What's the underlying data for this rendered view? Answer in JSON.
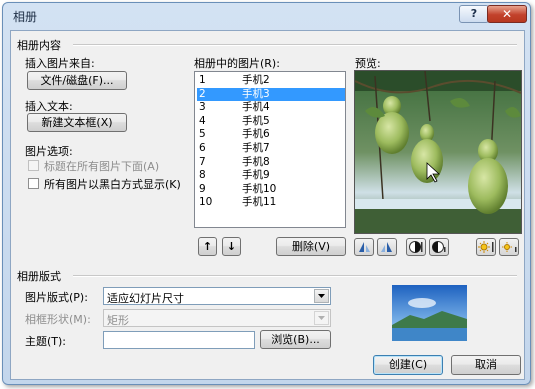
{
  "window": {
    "title": "相册",
    "help": "?",
    "close": "✕"
  },
  "album_content": {
    "section_title": "相册内容",
    "insert_from": "插入图片来自:",
    "file_disk_button": "文件/磁盘(F)...",
    "insert_text": "插入文本:",
    "new_textbox_button": "新建文本框(X)",
    "picture_options": "图片选项:",
    "option_caption": "标题在所有图片下面(A)",
    "option_bw": "所有图片以黑白方式显示(K)"
  },
  "pictures": {
    "header": "相册中的图片(R):",
    "items": [
      {
        "num": "1",
        "name": "手机2"
      },
      {
        "num": "2",
        "name": "手机3"
      },
      {
        "num": "3",
        "name": "手机4"
      },
      {
        "num": "4",
        "name": "手机5"
      },
      {
        "num": "5",
        "name": "手机6"
      },
      {
        "num": "6",
        "name": "手机7"
      },
      {
        "num": "7",
        "name": "手机8"
      },
      {
        "num": "8",
        "name": "手机9"
      },
      {
        "num": "9",
        "name": "手机10"
      },
      {
        "num": "10",
        "name": "手机11"
      }
    ],
    "selected_index": 1,
    "up_arrow": "↑",
    "down_arrow": "↓",
    "delete_button": "删除(V)"
  },
  "preview": {
    "label": "预览:"
  },
  "layout": {
    "section_title": "相册版式",
    "picture_layout_label": "图片版式(P):",
    "picture_layout_value": "适应幻灯片尺寸",
    "frame_shape_label": "相框形状(M):",
    "frame_shape_value": "矩形",
    "theme_label": "主题(T):",
    "theme_value": "",
    "browse_button": "浏览(B)..."
  },
  "buttons": {
    "create": "创建(C)",
    "cancel": "取消"
  },
  "colors": {
    "selection": "#3399ff",
    "titlebar": "#c7daf0",
    "close": "#c2412b"
  }
}
